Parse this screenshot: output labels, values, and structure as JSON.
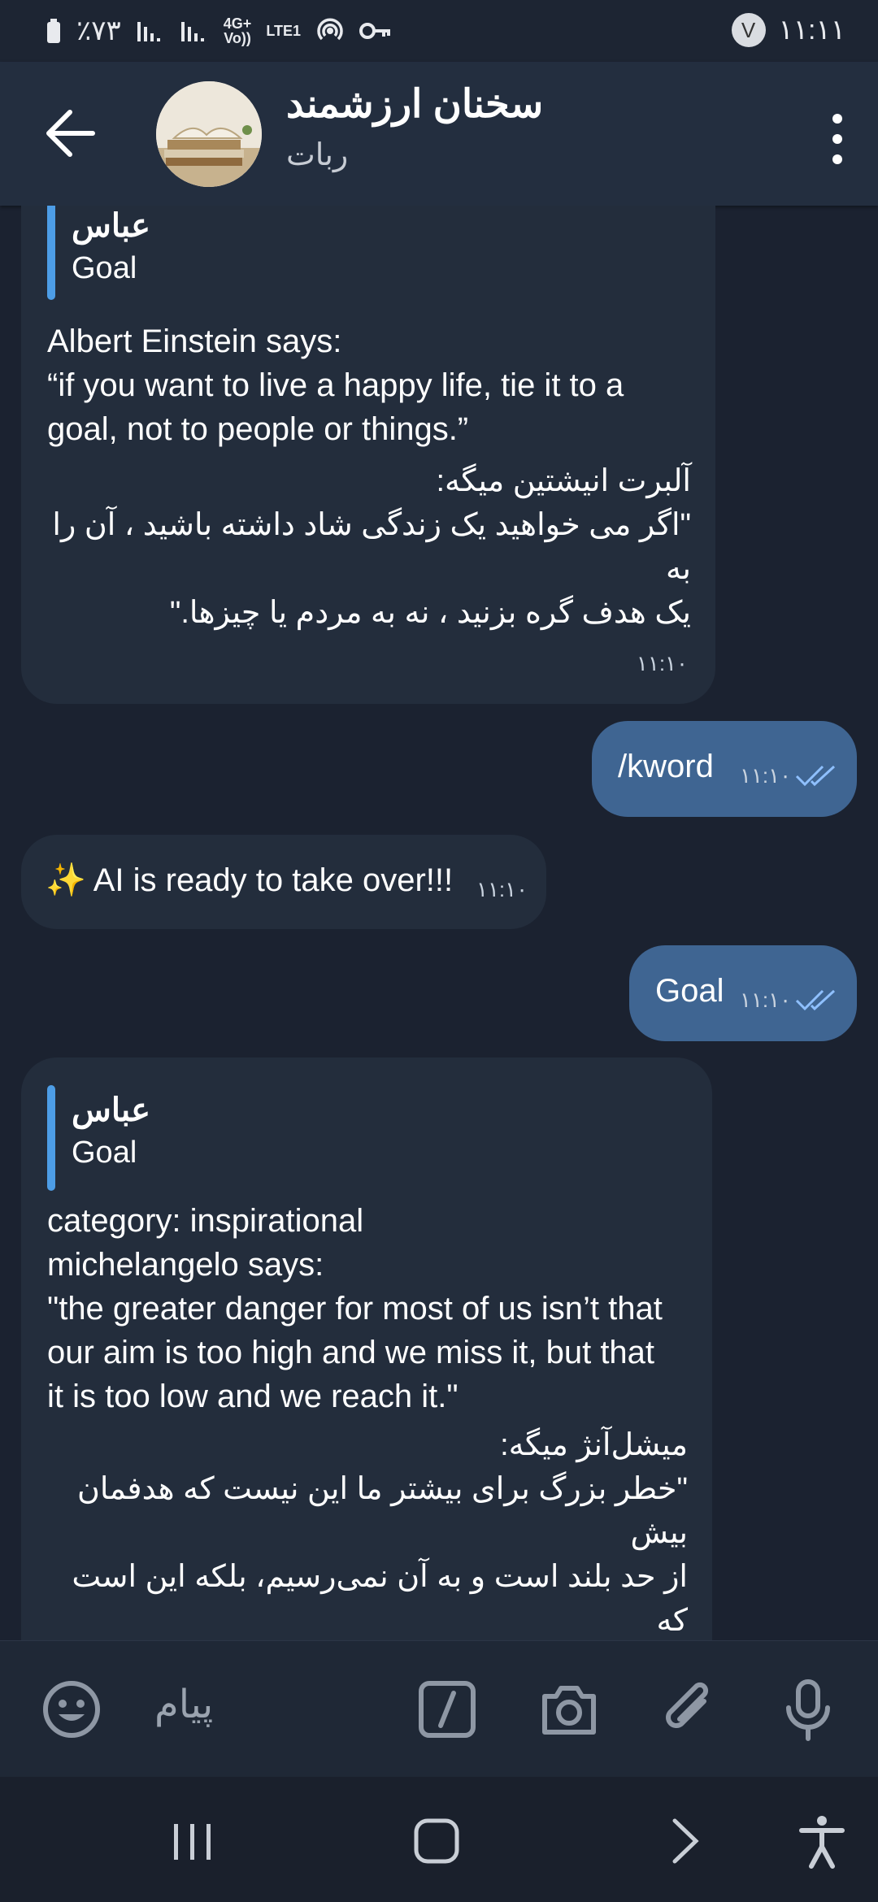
{
  "status_bar": {
    "battery": "٪۷۳",
    "net_top": "4G+",
    "net_bottom": "LTE1",
    "volte_top": "Vo))",
    "avatar_letter": "V",
    "time": "۱۱:۱۱"
  },
  "header": {
    "title": "سخنان ارزشمند",
    "subtitle": "ربات"
  },
  "messages": {
    "m1": {
      "reply_name": "عباس",
      "reply_text": "Goal",
      "english": "Albert Einstein says:\n“if you want to live a happy life, tie it to a\ngoal, not to people or things.”",
      "persian": "آلبرت انیشتین میگه:\n\"اگر می خواهید یک زندگی شاد داشته باشید ، آن را به\nیک هدف گره بزنید ، نه به مردم یا چیزها.\"",
      "time": "۱۱:۱۰"
    },
    "m2": {
      "text": "/kword",
      "time": "۱۱:۱۰"
    },
    "m3": {
      "text": "✨ AI is ready to take over!!!",
      "time": "۱۱:۱۰"
    },
    "m4": {
      "text": "Goal",
      "time": "۱۱:۱۰"
    },
    "m5": {
      "reply_name": "عباس",
      "reply_text": "Goal",
      "english": "category: inspirational\nmichelangelo says:\n\"the greater danger for most of us isn’t that\nour aim is too high and we miss it, but that\nit is too low and we reach it.\"",
      "persian": "میشل‌آنژ میگه:\n\"خطر بزرگ برای بیشتر ما این نیست که هدفمان بیش\nاز حد بلند است و به آن نمی‌رسیم، بلکه این است که\nهدفمان بیش از حد پایین است و به آن دست\nمی‌یابیم.\""
    }
  },
  "composer": {
    "placeholder": "پیام"
  },
  "colors": {
    "accent": "#4d9de6",
    "outgoing": "#3f6592",
    "incoming": "#232d3c",
    "background": "#1b2230"
  },
  "icons": {
    "back": "arrow-left-icon",
    "menu": "more-vertical-icon",
    "emoji": "emoji-icon",
    "command": "slash-command-icon",
    "camera": "camera-icon",
    "attach": "paperclip-icon",
    "mic": "microphone-icon",
    "recents": "recent-apps-icon",
    "home": "home-icon",
    "nav_back": "nav-back-icon",
    "accessibility": "accessibility-icon"
  }
}
